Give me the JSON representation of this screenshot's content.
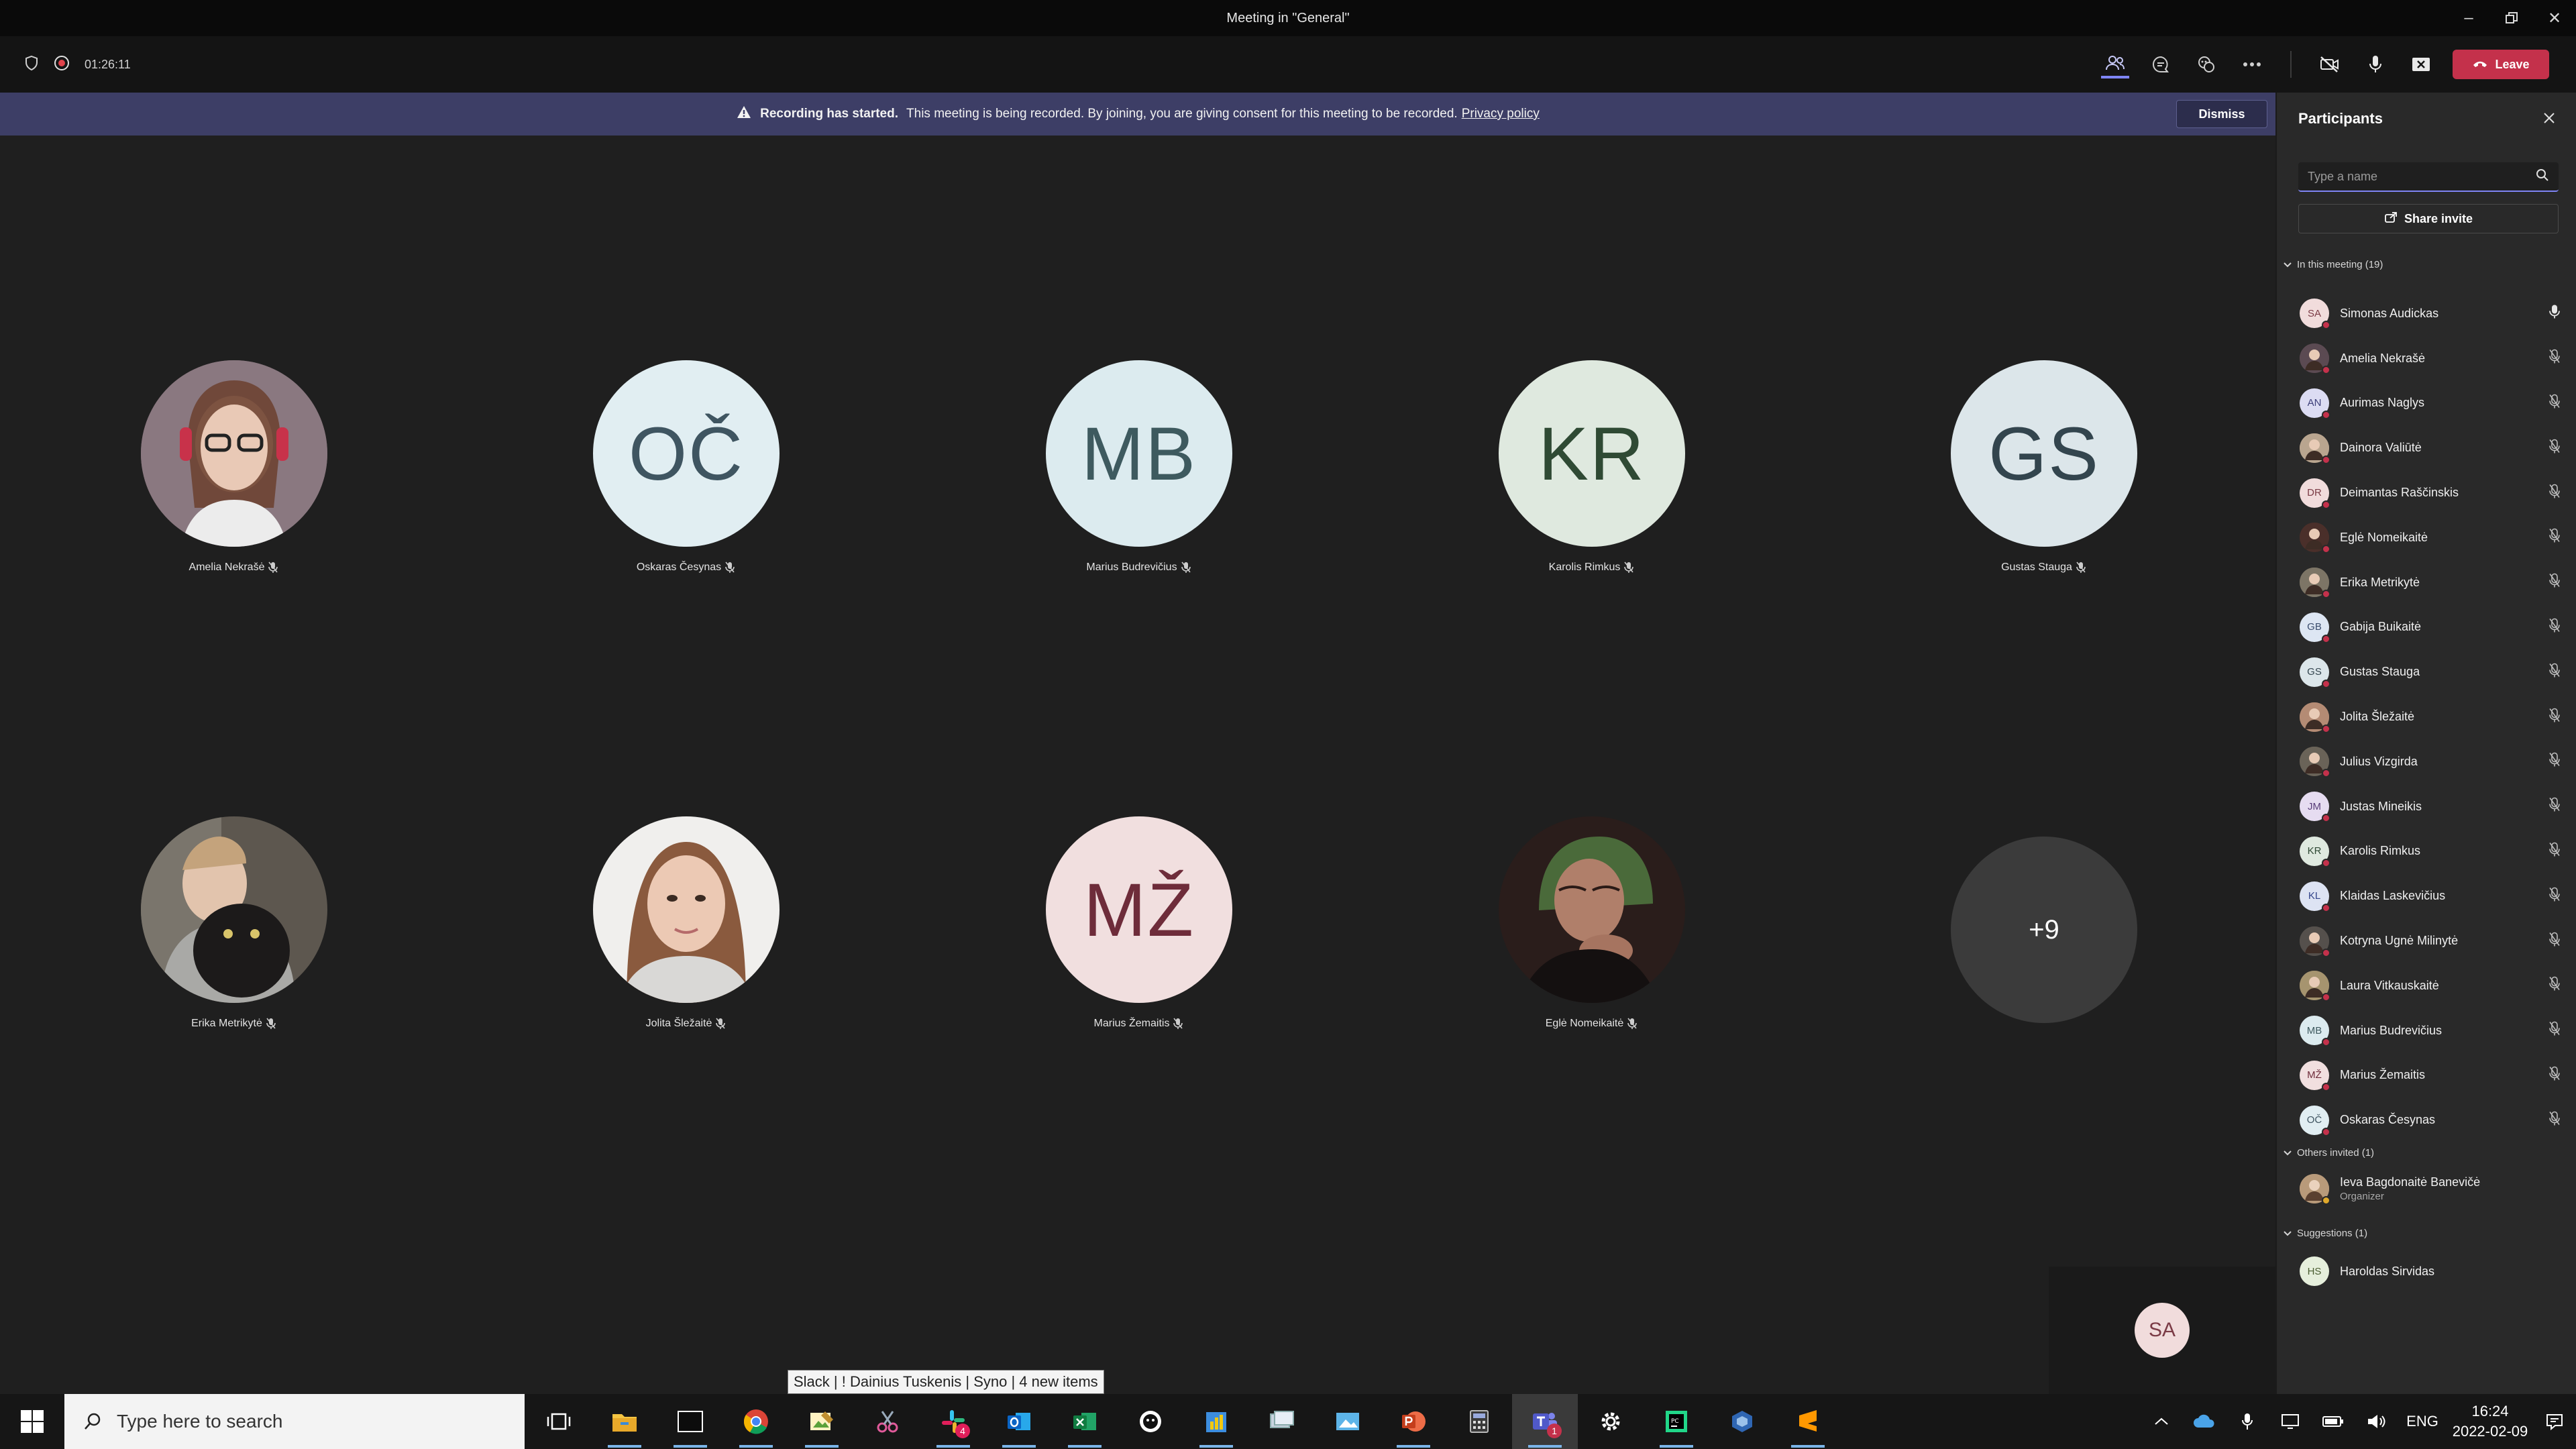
{
  "window": {
    "title": "Meeting in \"General\""
  },
  "toolbar": {
    "timer": "01:26:11",
    "leave_label": "Leave"
  },
  "banner": {
    "bold": "Recording has started.",
    "text": "This meeting is being recorded. By joining, you are giving consent for this meeting to be recorded.",
    "link": "Privacy policy",
    "dismiss": "Dismiss"
  },
  "stage": {
    "tiles": [
      {
        "name": "Amelia Nekrašė",
        "initials": "",
        "photo": true,
        "bg": "#6b5a60"
      },
      {
        "name": "Oskaras Česynas",
        "initials": "OČ",
        "bg": "#e1eef2",
        "fg": "#3f5561"
      },
      {
        "name": "Marius Budrevičius",
        "initials": "MB",
        "bg": "#dcebef",
        "fg": "#3e5a5f"
      },
      {
        "name": "Karolis Rimkus",
        "initials": "KR",
        "bg": "#dfe9df",
        "fg": "#2f4a34"
      },
      {
        "name": "Gustas Stauga",
        "initials": "GS",
        "bg": "#dce6ea",
        "fg": "#33454e"
      },
      {
        "name": "Erika Metrikytė",
        "initials": "",
        "photo": true,
        "bg": "#6e6e6a"
      },
      {
        "name": "Jolita Šležaitė",
        "initials": "",
        "photo": true,
        "bg": "#caa48e"
      },
      {
        "name": "Marius Žemaitis",
        "initials": "MŽ",
        "bg": "#f1dfdf",
        "fg": "#6e2c3a"
      },
      {
        "name": "Eglė Nomeikaitė",
        "initials": "",
        "photo": true,
        "bg": "#3a2a28"
      }
    ],
    "overflow": "+9",
    "self_initials": "SA"
  },
  "panel": {
    "title": "Participants",
    "search_placeholder": "Type a name",
    "share_label": "Share invite",
    "in_meeting_label": "In this meeting (19)",
    "participants": [
      {
        "name": "Simonas Audickas",
        "initials": "SA",
        "bg": "#f1dcdc",
        "fg": "#7b3b46",
        "mic": "on"
      },
      {
        "name": "Amelia Nekrašė",
        "initials": "",
        "bg": "#5b4a52",
        "mic": "off"
      },
      {
        "name": "Aurimas Naglys",
        "initials": "AN",
        "bg": "#dcdcf3",
        "fg": "#3d3f7a",
        "mic": "off"
      },
      {
        "name": "Dainora Valiūtė",
        "initials": "",
        "bg": "#b9a58f",
        "mic": "off"
      },
      {
        "name": "Deimantas Raščinskis",
        "initials": "DR",
        "bg": "#f1dcdc",
        "fg": "#7b3b46",
        "mic": "off"
      },
      {
        "name": "Eglė Nomeikaitė",
        "initials": "",
        "bg": "#4a2f2a",
        "mic": "off"
      },
      {
        "name": "Erika Metrikytė",
        "initials": "",
        "bg": "#7d7566",
        "mic": "off"
      },
      {
        "name": "Gabija Buikaitė",
        "initials": "GB",
        "bg": "#dde6f3",
        "fg": "#3a4c6d",
        "mic": "off"
      },
      {
        "name": "Gustas Stauga",
        "initials": "GS",
        "bg": "#dce6ea",
        "fg": "#33454e",
        "mic": "off"
      },
      {
        "name": "Jolita Šležaitė",
        "initials": "",
        "bg": "#b48b74",
        "mic": "off"
      },
      {
        "name": "Julius Vizgirda",
        "initials": "",
        "bg": "#6a6358",
        "mic": "off"
      },
      {
        "name": "Justas Mineikis",
        "initials": "JM",
        "bg": "#e6dcf1",
        "fg": "#5a3d7a",
        "mic": "off"
      },
      {
        "name": "Karolis Rimkus",
        "initials": "KR",
        "bg": "#dfe9df",
        "fg": "#2f4a34",
        "mic": "off"
      },
      {
        "name": "Klaidas Laskevičius",
        "initials": "KL",
        "bg": "#dde3f3",
        "fg": "#33448a",
        "mic": "off"
      },
      {
        "name": "Kotryna Ugnė Milinytė",
        "initials": "",
        "bg": "#55504c",
        "mic": "off"
      },
      {
        "name": "Laura Vitkauskaitė",
        "initials": "",
        "bg": "#a6946f",
        "mic": "off"
      },
      {
        "name": "Marius Budrevičius",
        "initials": "MB",
        "bg": "#dcebef",
        "fg": "#3e5a5f",
        "mic": "off"
      },
      {
        "name": "Marius Žemaitis",
        "initials": "MŽ",
        "bg": "#f1dfdf",
        "fg": "#6e2c3a",
        "mic": "off"
      },
      {
        "name": "Oskaras Česynas",
        "initials": "OČ",
        "bg": "#e1eef2",
        "fg": "#3f5561",
        "mic": "off"
      }
    ],
    "others_label": "Others invited (1)",
    "others": [
      {
        "name": "Ieva Bagdonaitė Banevičė",
        "role": "Organizer",
        "initials": "",
        "bg": "#b89a7a"
      }
    ],
    "suggestions_label": "Suggestions (1)",
    "suggestions": [
      {
        "name": "Haroldas Sirvidas",
        "initials": "HS",
        "bg": "#e6efdc",
        "fg": "#4a5d31"
      }
    ]
  },
  "taskbar": {
    "search_placeholder": "Type here to search",
    "tooltip": "Slack | ! Dainius Tuskenis | Syno | 4 new items",
    "language": "ENG",
    "time": "16:24",
    "date": "2022-02-09",
    "badges": {
      "slack": "4",
      "teams": "1"
    }
  }
}
